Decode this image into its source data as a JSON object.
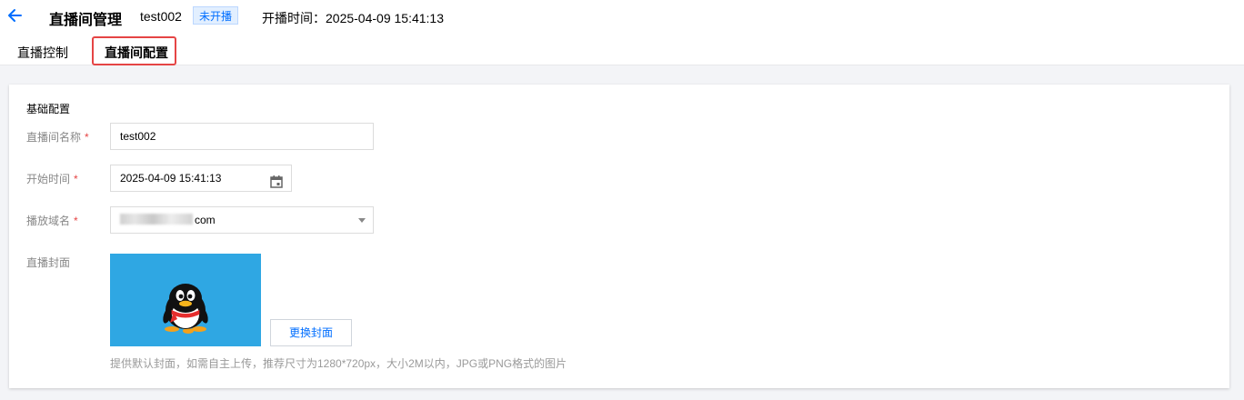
{
  "header": {
    "back_icon": "arrow-left-icon",
    "title": "直播间管理",
    "room_name": "test002",
    "status": "未开播",
    "start_time_label": "开播时间：",
    "start_time_value": "2025-04-09 15:41:13",
    "accent_color": "#006eff"
  },
  "tabs": [
    {
      "label": "直播控制",
      "active": false
    },
    {
      "label": "直播间配置",
      "active": true
    }
  ],
  "form": {
    "section_title": "基础配置",
    "name": {
      "label": "直播间名称",
      "value": "test002",
      "required": true
    },
    "start_time": {
      "label": "开始时间",
      "value": "2025-04-09 15:41:13",
      "required": true,
      "icon": "calendar-icon"
    },
    "domain": {
      "label": "播放域名",
      "value_suffix": "com",
      "required": true,
      "icon": "chevron-down-icon"
    },
    "cover": {
      "label": "直播封面",
      "image": "qq-penguin-cover",
      "background_color": "#2fa7e3",
      "replace_button": "更换封面",
      "hint": "提供默认封面，如需自主上传，推荐尺寸为1280*720px，大小2M以内，JPG或PNG格式的图片"
    }
  }
}
